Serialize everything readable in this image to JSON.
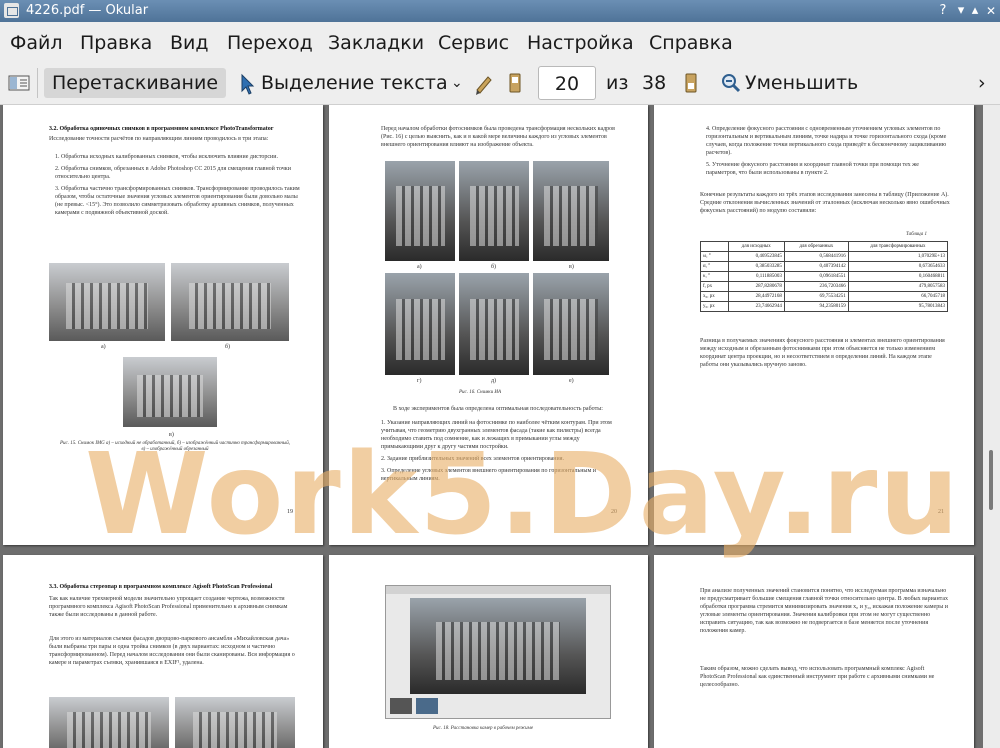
{
  "window": {
    "title": "4226.pdf — Okular"
  },
  "menu": [
    "Файл",
    "Правка",
    "Вид",
    "Переход",
    "Закладки",
    "Сервис",
    "Настройка",
    "Справка"
  ],
  "toolbar": {
    "browse": "Перетаскивание",
    "select_text": "Выделение текста",
    "page": "20",
    "of": "из",
    "total": "38",
    "zoom_out": "Уменьшить"
  },
  "watermark": "Work5.Day.ru",
  "pages": {
    "p19": {
      "heading": "3.2. Обработка одиночных снимков в программном комплексе PhotoTransformator",
      "intro": "Исследование точности расчётов по направляющим линиям проводилось в три этапа:",
      "items": [
        "1. Обработка исходных калиброванных снимков, чтобы исключить влияние дисторсии.",
        "2. Обработка снимков, обрезанных в Adobe Photoshop CC 2015 для смещения главной точки относительно центра.",
        "3. Обработка частично трансформированных снимков. Трансформирование проводилось таким образом, чтобы остаточные значения угловых элементов ориентирования были довольно малы (не превыс. <15°). Это позволило симметризовать обработку архивных снимков, полученных камерами с подвижной объективной доской."
      ],
      "fig_labels": [
        "а)",
        "б)",
        "в)"
      ],
      "caption": "Рис. 15. Снимок IMG а) – исходный не обработанный, б) – изображённый частично трансформированный, в) – изображённый обрезанный",
      "number": "19"
    },
    "p20": {
      "intro": "Перед началом обработки фотоснимков была проведена трансформация нескольких кадров (Рис. 16) с целью выяснить, как и в какой мере величины каждого из угловых элементов внешнего ориентирования влияют на изображение объекта.",
      "fig_labels": [
        "а)",
        "б)",
        "в)",
        "г)",
        "д)",
        "е)"
      ],
      "caption": "Рис. 16. Снимки ИА",
      "lead": "В ходе экспериментов была определена оптимальная последовательность работы:",
      "items": [
        "1. Указание направляющих линий на фотоснимке по наиболее чётким контурам. При этом учитывая, что геометрию двухгранных элементов фасада (такие как пилястры) всегда необходимо ставить под сомнение, как и лежащих в примыкании углы между примыкающими друг к другу частями постройки.",
        "2. Задание приблизительных значений всех элементов ориентирования.",
        "3. Определение угловых элементов внешнего ориентирования по горизонтальным и вертикальным линиям."
      ],
      "number": "20"
    },
    "p21": {
      "items": [
        "4. Определение фокусного расстояния с одновременным уточнением угловых элементов по горизонтальным и вертикальным линиям, точке надира и точке горизонтального схода (кроме случаев, когда положение точки вертикального схода приведёт к бесконечному зацикливанию расчетов).",
        "5. Уточнение фокусного расстояния и координат главной точки при помощи тех же параметров, что были использованы в пункте 2."
      ],
      "summary": "Конечные результаты каждого из трёх этапов исследования занесены в таблицу (Приложение А). Средние отклонения вычисленных значений от эталонных (исключая несколько явно ошибочных фокусных расстояний) по модулю составили:",
      "table_label": "Таблица 1",
      "table": {
        "headers": [
          "",
          "для исходных",
          "для обрезанных",
          "для трансформированных"
        ],
        "rows": [
          [
            "ω, °",
            "0,469523845",
            "0,568441916",
            "1,07029E+13"
          ],
          [
            "α, °",
            "0,385033285",
            "0,407394142",
            "0,673654633"
          ],
          [
            "κ, °",
            "0,111885003",
            "0,096184551",
            "0,160468811"
          ],
          [
            "f, px",
            "287,8280678",
            "236,7203466",
            "479,8057583"
          ],
          [
            "x₀, px",
            "28,44972168",
            "69,75534251",
            "66,7045718"
          ],
          [
            "y₀, px",
            "23,74662944",
            "94,23580159",
            "95,78013843"
          ]
        ]
      },
      "after": "Разница в получаемых значениях фокусного расстояния и элементах внешнего ориентирования между исходным и обрезанным фотоснимками при этом объясняется не только изменением координат центра проекции, но и несоответствием в определении линий. На каждом этапе работы они указывались вручную заново.",
      "number": "21"
    },
    "p22": {
      "heading": "3.3. Обработка стереопар в программном комплексе Agisoft PhotoScan Professional",
      "para1": "Так как наличие трехмерной модели значительно упрощает создание чертежа, возможности программного комплекса Agisoft PhotoScan Professional применительно к архивным снимкам также были исследованы в данной работе.",
      "para2": "Для этого из материалов съемки фасадов дворцово-паркового ансамбля «Михайловская дача» были выбраны три пары и одна тройка снимков (в двух вариантах: исходном и частично трансформированном). Перед началом исследования они были сканированы. Вся информация о камере и параметрах съемки, хранившаяся в EXIF¹, удалена."
    },
    "p23": {
      "caption": "Рис. 18. Расстановка камер в рабочем режиме"
    },
    "p24": {
      "para1": "При анализе полученных значений становится понятно, что исследуемая программа изначально не предусматривает большие смещения главной точки относительно центра. В любых вариантах обработки программа стремится минимизировать значения x₀ и y₀, искажая положение камеры и угловые элементы ориентирования. Значения калибровки при этом не могут существенно исправить ситуацию, так как возможно не подвергается в базе меняется после уточнения положения камер.",
      "para2": "Таким образом, можно сделать вывод, что использовать программный комплекс Agisoft PhotoScan Professional как единственный инструмент при работе с архивными снимками не целесообразно."
    }
  }
}
